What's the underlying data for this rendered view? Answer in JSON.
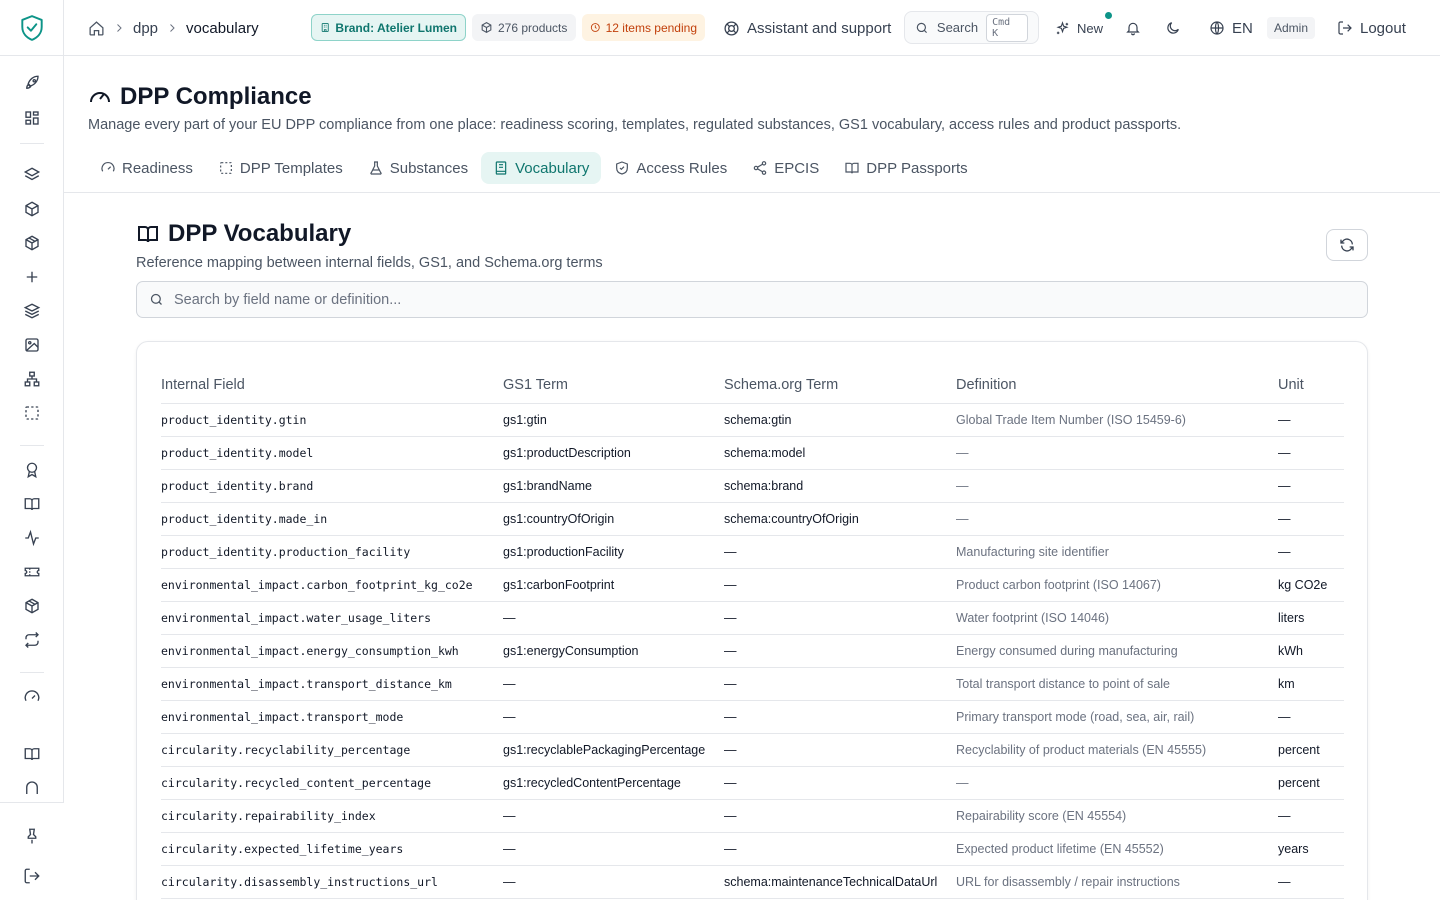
{
  "breadcrumb": {
    "items": [
      "dpp",
      "vocabulary"
    ]
  },
  "topbar": {
    "brand_badge": "Brand: Atelier Lumen",
    "products_badge": "276 products",
    "pending_badge": "12 items pending",
    "assistant": "Assistant and support",
    "search_label": "Search",
    "search_shortcut": "Cmd K",
    "new_label": "New",
    "language": "EN",
    "role": "Admin",
    "logout": "Logout"
  },
  "page": {
    "title": "DPP Compliance",
    "description": "Manage every part of your EU DPP compliance from one place: readiness scoring, templates, regulated substances, GS1 vocabulary, access rules and product passports."
  },
  "tabs": [
    {
      "label": "Readiness",
      "icon": "gauge-icon",
      "active": false
    },
    {
      "label": "DPP Templates",
      "icon": "dashed-square-icon",
      "active": false
    },
    {
      "label": "Substances",
      "icon": "flask-icon",
      "active": false
    },
    {
      "label": "Vocabulary",
      "icon": "book-icon",
      "active": true
    },
    {
      "label": "Access Rules",
      "icon": "shield-icon",
      "active": false
    },
    {
      "label": "EPCIS",
      "icon": "share-icon",
      "active": false
    },
    {
      "label": "DPP Passports",
      "icon": "open-book-icon",
      "active": false
    }
  ],
  "section": {
    "title": "DPP Vocabulary",
    "description": "Reference mapping between internal fields, GS1, and Schema.org terms",
    "search_placeholder": "Search by field name or definition..."
  },
  "table": {
    "columns": [
      "Internal Field",
      "GS1 Term",
      "Schema.org Term",
      "Definition",
      "Unit"
    ],
    "rows": [
      [
        "product_identity.gtin",
        "gs1:gtin",
        "schema:gtin",
        "Global Trade Item Number (ISO 15459-6)",
        "—"
      ],
      [
        "product_identity.model",
        "gs1:productDescription",
        "schema:model",
        "—",
        "—"
      ],
      [
        "product_identity.brand",
        "gs1:brandName",
        "schema:brand",
        "—",
        "—"
      ],
      [
        "product_identity.made_in",
        "gs1:countryOfOrigin",
        "schema:countryOfOrigin",
        "—",
        "—"
      ],
      [
        "product_identity.production_facility",
        "gs1:productionFacility",
        "—",
        "Manufacturing site identifier",
        "—"
      ],
      [
        "environmental_impact.carbon_footprint_kg_co2e",
        "gs1:carbonFootprint",
        "—",
        "Product carbon footprint (ISO 14067)",
        "kg CO2e"
      ],
      [
        "environmental_impact.water_usage_liters",
        "—",
        "—",
        "Water footprint (ISO 14046)",
        "liters"
      ],
      [
        "environmental_impact.energy_consumption_kwh",
        "gs1:energyConsumption",
        "—",
        "Energy consumed during manufacturing",
        "kWh"
      ],
      [
        "environmental_impact.transport_distance_km",
        "—",
        "—",
        "Total transport distance to point of sale",
        "km"
      ],
      [
        "environmental_impact.transport_mode",
        "—",
        "—",
        "Primary transport mode (road, sea, air, rail)",
        "—"
      ],
      [
        "circularity.recyclability_percentage",
        "gs1:recyclablePackagingPercentage",
        "—",
        "Recyclability of product materials (EN 45555)",
        "percent"
      ],
      [
        "circularity.recycled_content_percentage",
        "gs1:recycledContentPercentage",
        "—",
        "—",
        "percent"
      ],
      [
        "circularity.repairability_index",
        "—",
        "—",
        "Repairability score (EN 45554)",
        "—"
      ],
      [
        "circularity.expected_lifetime_years",
        "—",
        "—",
        "Expected product lifetime (EN 45552)",
        "years"
      ],
      [
        "circularity.disassembly_instructions_url",
        "—",
        "schema:maintenanceTechnicalDataUrl",
        "URL for disassembly / repair instructions",
        "—"
      ]
    ]
  },
  "colors": {
    "accent": "#0d9488",
    "accent_bg": "#e6f5f3",
    "warning": "#c2410c"
  }
}
